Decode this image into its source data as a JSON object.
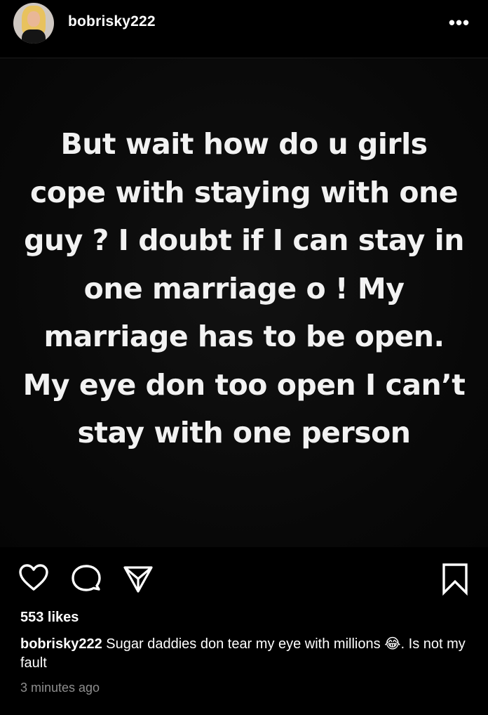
{
  "header": {
    "username": "bobrisky222",
    "more_label": "•••"
  },
  "post": {
    "text": "But wait how do u girls cope with staying with one guy ? I doubt if I can stay in one marriage o ! My marriage has to be open. My eye don too open I can’t stay with one person"
  },
  "actions": {
    "like_icon": "heart-icon",
    "comment_icon": "comment-icon",
    "share_icon": "send-icon",
    "save_icon": "bookmark-icon"
  },
  "likes": "553 likes",
  "caption": {
    "username": "bobrisky222",
    "text": " Sugar daddies don tear my eye with millions 😂. Is not my fault"
  },
  "timestamp": "3 minutes ago"
}
